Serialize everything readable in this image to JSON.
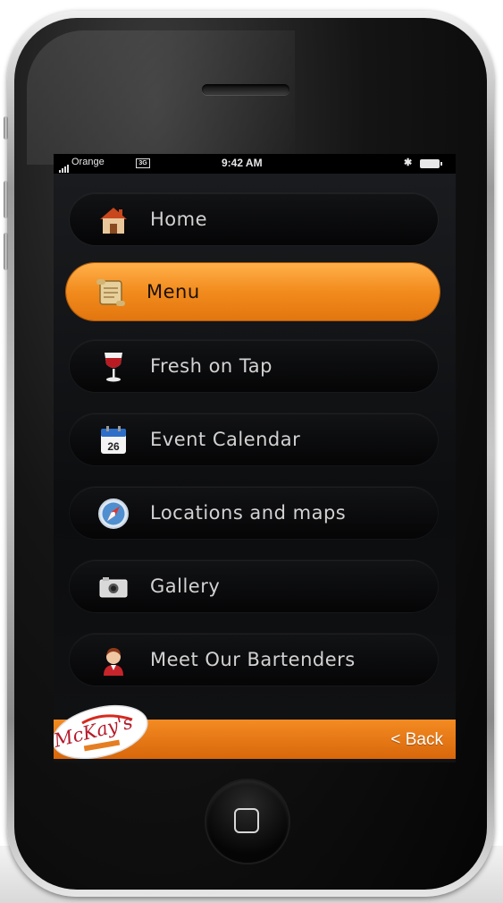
{
  "status_bar": {
    "carrier": "Orange",
    "network_badge": "3G",
    "time": "9:42 AM",
    "bluetooth": "✱"
  },
  "menu": {
    "items": [
      {
        "label": "Home",
        "icon": "home-icon",
        "active": false
      },
      {
        "label": "Menu",
        "icon": "scroll-icon",
        "active": true
      },
      {
        "label": "Fresh on Tap",
        "icon": "wine-glass-icon",
        "active": false
      },
      {
        "label": "Event Calendar",
        "icon": "calendar-icon",
        "active": false,
        "icon_text": "26"
      },
      {
        "label": "Locations and maps",
        "icon": "compass-icon",
        "active": false
      },
      {
        "label": "Gallery",
        "icon": "camera-icon",
        "active": false
      },
      {
        "label": "Meet Our Bartenders",
        "icon": "bartender-icon",
        "active": false
      }
    ]
  },
  "footer": {
    "logo_text": "McKay's",
    "back_label": "< Back"
  },
  "colors": {
    "accent": "#f28b1d",
    "screen_bg": "#0c0d0f",
    "item_bg": "#0b0c0d",
    "label": "#d2d2d2"
  }
}
